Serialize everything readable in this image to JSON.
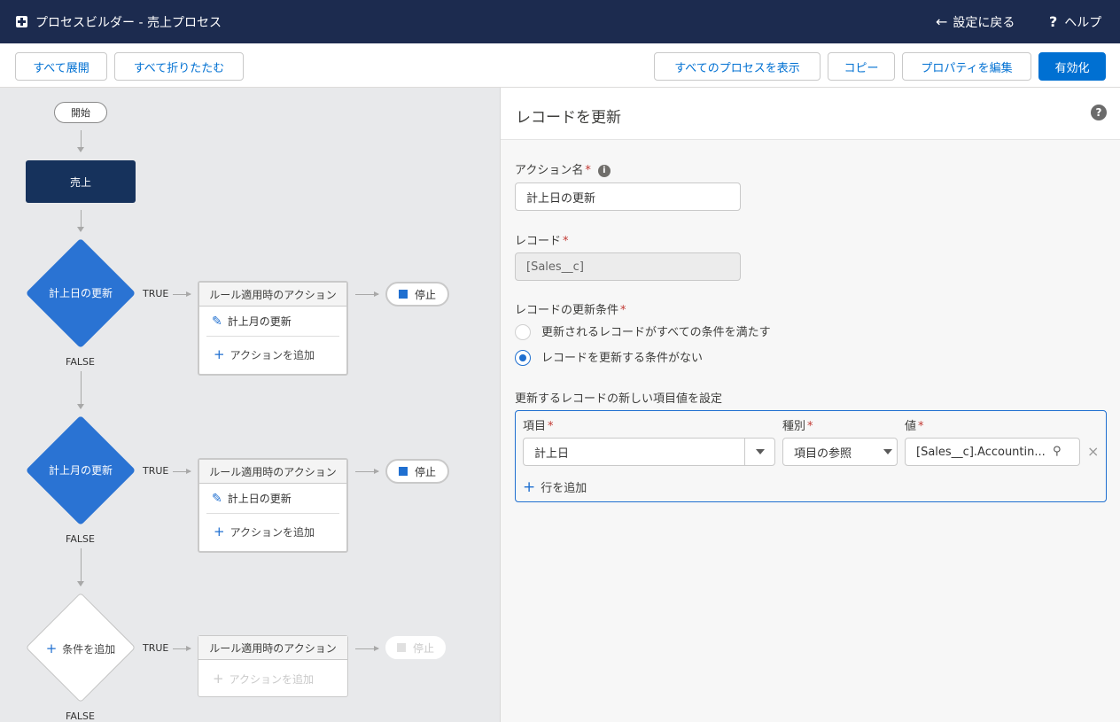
{
  "topbar": {
    "title": "プロセスビルダー - 売上プロセス",
    "back_label": "設定に戻る",
    "help_label": "ヘルプ"
  },
  "toolbar": {
    "expand_all": "すべて展開",
    "collapse_all": "すべて折りたたむ",
    "view_all_processes": "すべてのプロセスを表示",
    "copy": "コピー",
    "edit_properties": "プロパティを編集",
    "activate": "有効化"
  },
  "canvas": {
    "start_label": "開始",
    "object_label": "売上",
    "true_label": "TRUE",
    "false_label": "FALSE",
    "criteria": [
      {
        "name": "計上日の更新",
        "action_header": "ルール適用時のアクション",
        "action_item": "計上月の更新",
        "add_action": "アクションを追加",
        "stop_label": "停止"
      },
      {
        "name": "計上月の更新",
        "action_header": "ルール適用時のアクション",
        "action_item": "計上日の更新",
        "add_action": "アクションを追加",
        "stop_label": "停止"
      },
      {
        "name": "条件を追加",
        "action_header": "ルール適用時のアクション",
        "add_action": "アクションを追加",
        "stop_label": "停止"
      }
    ]
  },
  "panel": {
    "title": "レコードを更新",
    "action_name_label": "アクション名",
    "action_name_value": "計上日の更新",
    "record_label": "レコード",
    "record_value": "[Sales__c]",
    "criteria_label": "レコードの更新条件",
    "criteria_options": [
      {
        "label": "更新されるレコードがすべての条件を満たす",
        "selected": false
      },
      {
        "label": "レコードを更新する条件がない",
        "selected": true
      }
    ],
    "set_fields_label": "更新するレコードの新しい項目値を設定",
    "col_field": "項目",
    "col_type": "種別",
    "col_value": "値",
    "row": {
      "field": "計上日",
      "type": "項目の参照",
      "value": "[Sales__c].Accountin..."
    },
    "add_row": "行を追加"
  },
  "colors": {
    "header_bg": "#1c2b4f",
    "brand_blue": "#0070d2",
    "diamond_blue": "#2a73d3",
    "object_navy": "#16325c",
    "required_red": "#c23934"
  }
}
